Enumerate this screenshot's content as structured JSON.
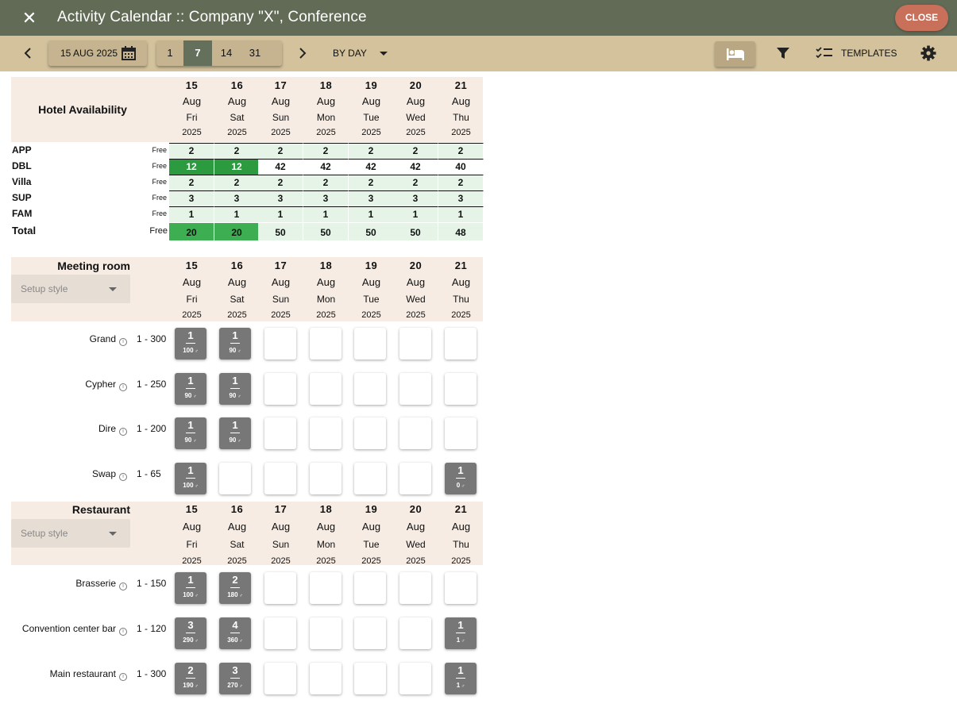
{
  "header": {
    "title": "Activity Calendar :: Company \"X\", Conference",
    "close_label": "CLOSE"
  },
  "toolbar": {
    "date": "15 AUG 2025",
    "spans": [
      "1",
      "7",
      "14",
      "31"
    ],
    "active_span": "7",
    "view_mode": "BY DAY",
    "templates_label": "TEMPLATES"
  },
  "dates": [
    {
      "day": "15",
      "month": "Aug",
      "weekday": "Fri",
      "year": "2025"
    },
    {
      "day": "16",
      "month": "Aug",
      "weekday": "Sat",
      "year": "2025"
    },
    {
      "day": "17",
      "month": "Aug",
      "weekday": "Sun",
      "year": "2025"
    },
    {
      "day": "18",
      "month": "Aug",
      "weekday": "Mon",
      "year": "2025"
    },
    {
      "day": "19",
      "month": "Aug",
      "weekday": "Tue",
      "year": "2025"
    },
    {
      "day": "20",
      "month": "Aug",
      "weekday": "Wed",
      "year": "2025"
    },
    {
      "day": "21",
      "month": "Aug",
      "weekday": "Thu",
      "year": "2025"
    }
  ],
  "hotel": {
    "title": "Hotel Availability",
    "free_label": "Free",
    "rooms": [
      {
        "name": "APP",
        "values": [
          "2",
          "2",
          "2",
          "2",
          "2",
          "2",
          "2"
        ]
      },
      {
        "name": "DBL",
        "values": [
          "12",
          "12",
          "42",
          "42",
          "42",
          "42",
          "40"
        ]
      },
      {
        "name": "Villa",
        "values": [
          "2",
          "2",
          "2",
          "2",
          "2",
          "2",
          "2"
        ]
      },
      {
        "name": "SUP",
        "values": [
          "3",
          "3",
          "3",
          "3",
          "3",
          "3",
          "3"
        ]
      },
      {
        "name": "FAM",
        "values": [
          "1",
          "1",
          "1",
          "1",
          "1",
          "1",
          "1"
        ]
      }
    ],
    "total": {
      "name": "Total",
      "values": [
        "20",
        "20",
        "50",
        "50",
        "50",
        "50",
        "48"
      ]
    }
  },
  "meeting": {
    "title": "Meeting room",
    "setup_placeholder": "Setup style",
    "rooms": [
      {
        "name": "Grand",
        "capacity": "1 - 300",
        "cells": [
          {
            "n": "1",
            "p": "100"
          },
          {
            "n": "1",
            "p": "90"
          },
          null,
          null,
          null,
          null,
          null
        ]
      },
      {
        "name": "Cypher",
        "capacity": "1 - 250",
        "cells": [
          {
            "n": "1",
            "p": "90"
          },
          {
            "n": "1",
            "p": "90"
          },
          null,
          null,
          null,
          null,
          null
        ]
      },
      {
        "name": "Dire",
        "capacity": "1 - 200",
        "cells": [
          {
            "n": "1",
            "p": "90"
          },
          {
            "n": "1",
            "p": "90"
          },
          null,
          null,
          null,
          null,
          null
        ]
      },
      {
        "name": "Swap",
        "capacity": "1 - 65",
        "cells": [
          {
            "n": "1",
            "p": "100"
          },
          null,
          null,
          null,
          null,
          null,
          {
            "n": "1",
            "p": "0"
          }
        ]
      }
    ]
  },
  "restaurant": {
    "title": "Restaurant",
    "setup_placeholder": "Setup style",
    "rooms": [
      {
        "name": "Brasserie",
        "capacity": "1 - 150",
        "cells": [
          {
            "n": "1",
            "p": "100"
          },
          {
            "n": "2",
            "p": "180"
          },
          null,
          null,
          null,
          null,
          null
        ]
      },
      {
        "name": "Convention center bar",
        "capacity": "1 - 120",
        "cells": [
          {
            "n": "3",
            "p": "290"
          },
          {
            "n": "4",
            "p": "360"
          },
          null,
          null,
          null,
          null,
          {
            "n": "1",
            "p": "1"
          }
        ]
      },
      {
        "name": "Main restaurant",
        "capacity": "1 - 300",
        "cells": [
          {
            "n": "2",
            "p": "190"
          },
          {
            "n": "3",
            "p": "270"
          },
          null,
          null,
          null,
          null,
          {
            "n": "1",
            "p": "1"
          }
        ]
      }
    ]
  },
  "colors": {
    "header": "#616b56",
    "toolbar": "#d3c29c",
    "close": "#c9705a",
    "avail_high": "#2c9a3f",
    "avail_low": "#e5f4e7",
    "booked": "#777777"
  }
}
